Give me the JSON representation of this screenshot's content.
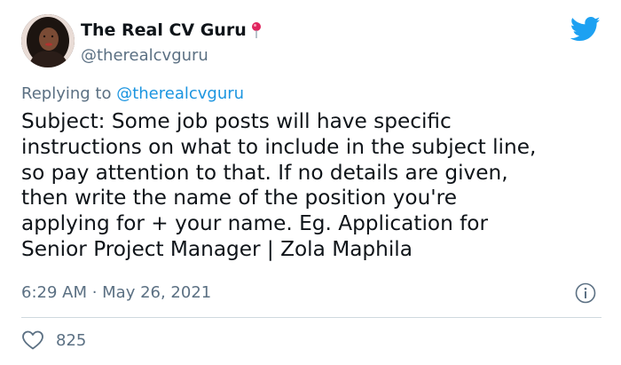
{
  "author": {
    "display_name": "The Real CV Guru",
    "handle": "@therealcvguru",
    "name_emoji": "pin-icon"
  },
  "reply": {
    "prefix": "Replying to ",
    "mention": "@therealcvguru"
  },
  "tweet": {
    "text": "Subject: Some job posts will have specific\ninstructions on what to include in the subject line,\nso pay attention to that. If no details are given,\nthen write the name of the position you're\napplying for + your name. Eg. Application for\nSenior Project Manager | Zola Maphila",
    "timestamp": "6:29 AM · May 26, 2021",
    "likes": "825"
  },
  "icons": {
    "brand": "twitter-bird-icon",
    "info": "info-icon",
    "like": "heart-icon"
  },
  "colors": {
    "brand": "#1da1f2",
    "secondary_text": "#5b7083",
    "mention": "#1b95e0",
    "divider": "#cfd9de"
  }
}
